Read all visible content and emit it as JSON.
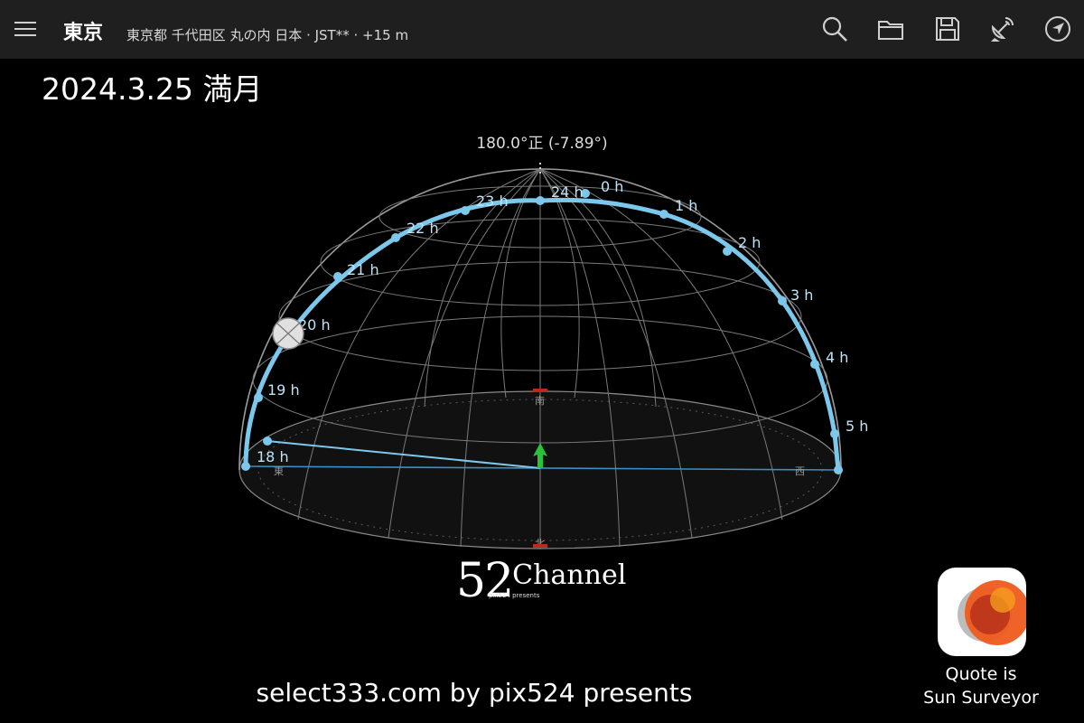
{
  "header": {
    "city": "東京",
    "location": "東京都 千代田区 丸の内 日本 · JST** · +15 m"
  },
  "title": "2024.3.25 満月",
  "view": {
    "heading": "180.0°正 (-7.89°)",
    "moon_hours": [
      "18 h",
      "19 h",
      "20 h",
      "21 h",
      "22 h",
      "23 h",
      "24 h",
      "0 h",
      "1 h",
      "2 h",
      "3 h",
      "4 h",
      "5 h"
    ],
    "compass": {
      "south": "南",
      "north": "北",
      "east": "東",
      "west": "西"
    }
  },
  "brand": {
    "num": "52",
    "word": "Channel",
    "sub": "pix524 presents"
  },
  "footer": "select333.com by pix524 presents",
  "app": {
    "quote_line1": "Quote is",
    "quote_line2": "Sun Surveyor"
  },
  "colors": {
    "path": "#7cc8ec",
    "topbar": "#1f1f1f",
    "grid": "#8a8a8a",
    "arrow": "#29c23a"
  }
}
